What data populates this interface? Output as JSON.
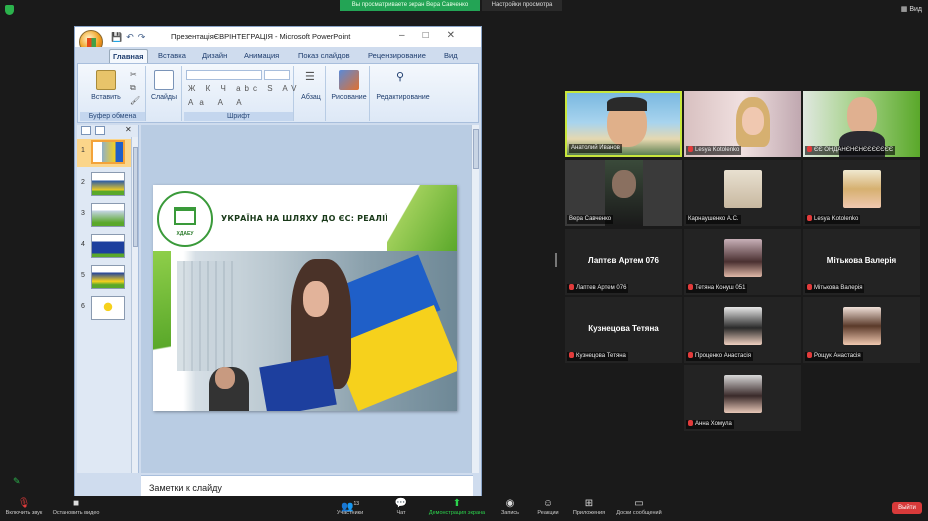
{
  "topbar": {
    "share_banner": "Вы просматриваете экран Вера Савченко",
    "view_options": "Настройки просмотра",
    "view_label": "Вид",
    "view_icon": "grid-icon"
  },
  "ppt": {
    "title": "ПрезентаціяЄВРІНТЕГРАЦІЯ - Microsoft PowerPoint",
    "tabs": [
      "Главная",
      "Вставка",
      "Дизайн",
      "Анимация",
      "Показ слайдов",
      "Рецензирование",
      "Вид"
    ],
    "ribbon": {
      "paste_label": "Вставить",
      "clipboard_label": "Буфер обмена",
      "slides_label": "Слайды",
      "font_label": "Шрифт",
      "paragraph_label": "Абзац",
      "drawing_label": "Рисование",
      "editing_label": "Редактирование",
      "font_buttons": [
        "Ж",
        "К",
        "Ч",
        "abc",
        "S",
        "AV"
      ],
      "font_buttons2": [
        "Aa",
        "A",
        "A"
      ]
    },
    "thumbnails": [
      "1",
      "2",
      "3",
      "4",
      "5",
      "6"
    ],
    "slide": {
      "title": "УКРАЇНА НА ШЛЯХУ ДО ЄС: РЕАЛІЇ І ПЕРСПЕКТИВИ",
      "logo_text": "ХДАЕУ"
    },
    "notes": "Заметки к слайду"
  },
  "participants": [
    {
      "label": "Анатолий Иванов",
      "muted": false,
      "video": true,
      "active": true
    },
    {
      "label": "Lesya Kotolenko",
      "muted": true,
      "video": true
    },
    {
      "label": "ЄЄ ОНДАНЄНЄНЄЄЄЄЄЄЄ",
      "muted": true,
      "video": true
    },
    {
      "label": "Вера Савченко",
      "muted": false,
      "video": true
    },
    {
      "label": "Карнаушенко А.С.",
      "muted": false,
      "video": false,
      "avatar": true
    },
    {
      "label": "Lesya Kotolenko",
      "muted": true,
      "video": false,
      "avatar": true
    },
    {
      "label": "Лаптев Артем 076",
      "muted": true,
      "video": false,
      "big_name": "Лаптєв Артем 076"
    },
    {
      "label": "Тетяна Конуш 051",
      "muted": true,
      "video": false,
      "avatar": true
    },
    {
      "label": "Мiтькова Валерiя",
      "muted": true,
      "video": false,
      "big_name": "Мiтькова Валерiя"
    },
    {
      "label": "Кузнецова Тетяна",
      "muted": true,
      "video": false,
      "big_name": "Кузнецова Тетяна"
    },
    {
      "label": "Проценко Анастасія",
      "muted": true,
      "video": false,
      "avatar": true
    },
    {
      "label": "Рощук Анастасія",
      "muted": true,
      "video": false,
      "avatar": true
    },
    {
      "label": "Анна Хомула",
      "muted": true,
      "video": false,
      "avatar": true
    }
  ],
  "toolbar": {
    "mute": "Включить звук",
    "video": "Остановить видео",
    "participants": "Участники",
    "participants_count": "13",
    "chat": "Чат",
    "share": "Демонстрация экрана",
    "record": "Запись",
    "reactions": "Реакции",
    "apps": "Приложения",
    "whiteboard": "Доски сообщений",
    "exit": "Выйти"
  }
}
